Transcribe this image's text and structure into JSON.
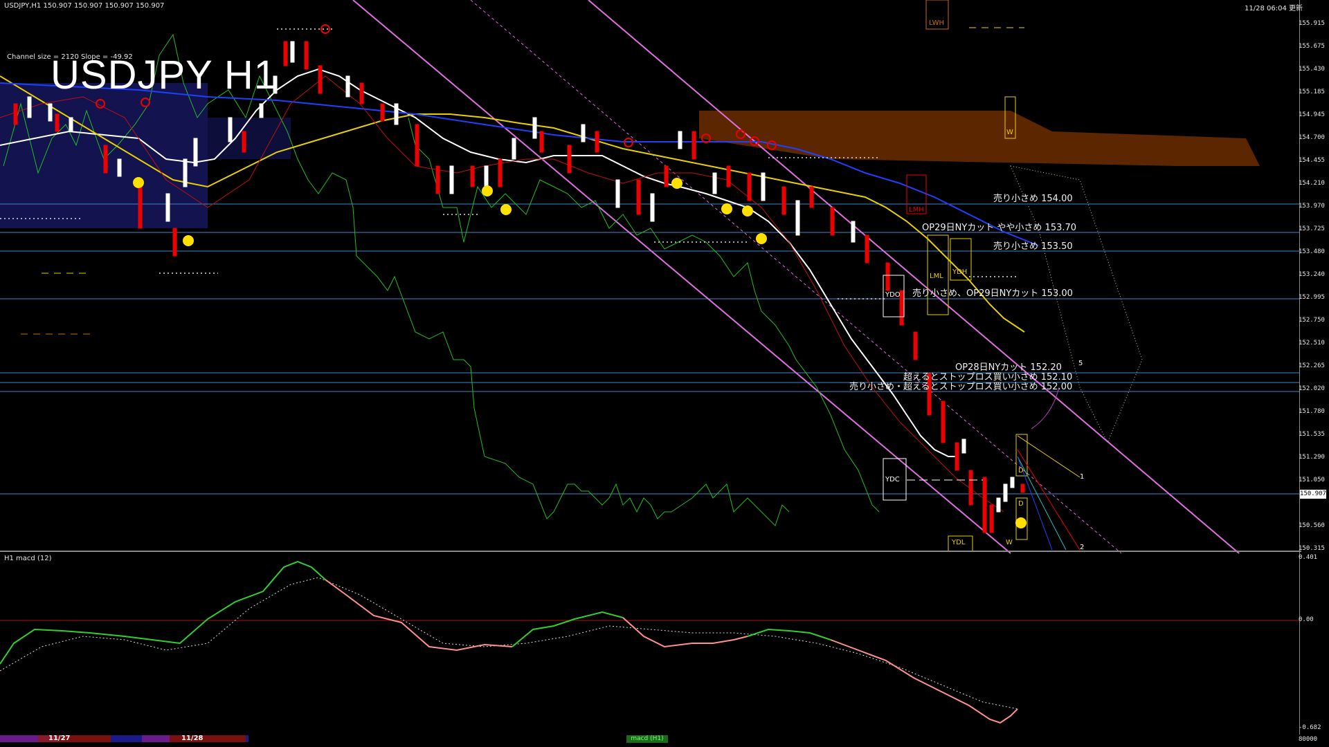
{
  "header": {
    "symbol_info": "USDJPY,H1  150.907 150.907 150.907 150.907",
    "clock": "11/28 06:04 更新",
    "channel_info": "Channel size = 2120 Slope = -49.92",
    "big_title": "USDJPY H1"
  },
  "levels": [
    {
      "label": "売り小さめ 154.00"
    },
    {
      "label": "OP29日NYカット やや小さめ 153.70"
    },
    {
      "label": "売り小さめ 153.50"
    },
    {
      "label": "売り小さめ、OP29日NYカット 153.00"
    },
    {
      "label": "OP28日NYカット 152.20"
    },
    {
      "label": "超えるとストップロス買い小さめ 152.10"
    },
    {
      "label": "売り小さめ・超えるとストップロス買い小さめ 152.00"
    }
  ],
  "price_axis": [
    "155.915",
    "155.675",
    "155.430",
    "155.185",
    "154.945",
    "154.700",
    "154.455",
    "154.210",
    "153.970",
    "153.725",
    "153.480",
    "153.240",
    "152.995",
    "152.750",
    "152.510",
    "152.265",
    "152.020",
    "151.780",
    "151.535",
    "151.290",
    "151.050",
    "150.560",
    "150.315"
  ],
  "current_price": "150.907",
  "box_labels": {
    "lwh": "LWH",
    "w_top": "W",
    "lmh": "LMH",
    "lml": "LML",
    "ydh": "YDH",
    "ydo": "YDO",
    "ydc": "YDC",
    "ydl": "YDL",
    "d1": "D",
    "d2": "D",
    "w_bottom": "W",
    "num5": "5",
    "num1": "1",
    "num2": "2"
  },
  "macd": {
    "label": "H1  macd (12)",
    "axis": [
      "0.401",
      "0.00",
      "-0.682",
      "80000"
    ]
  },
  "bottom_bar": {
    "date1": "11/27",
    "date2": "11/28",
    "button": "macd (H1)"
  },
  "colors": {
    "background": "#000000",
    "ichimoku_cloud": "#3a2a8a",
    "resistance_cloud": "#c85a00",
    "channel": "#e070e0",
    "ma_white": "#ffffff",
    "ma_yellow": "#e8d000",
    "ma_blue": "#2040ff",
    "chikou": "#20c020",
    "level_line": "#4a90d8",
    "macd_up": "#30d030",
    "macd_down": "#ff9090"
  }
}
